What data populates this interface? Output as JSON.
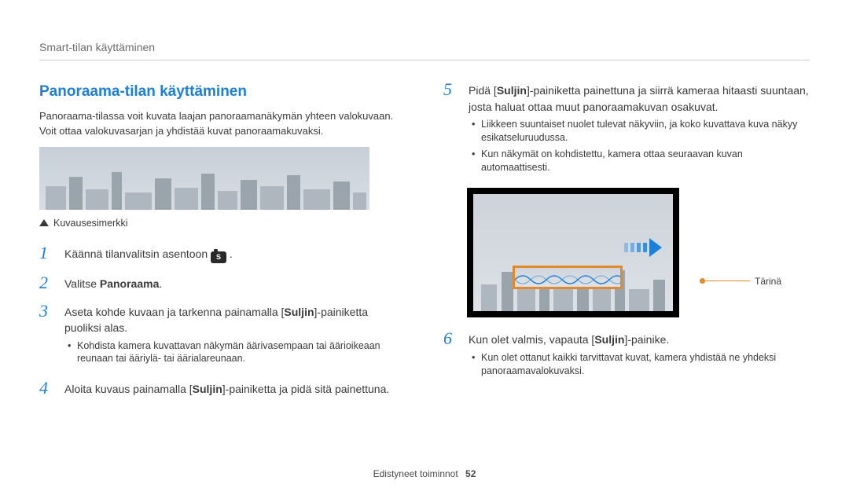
{
  "breadcrumb": "Smart-tilan käyttäminen",
  "section_title": "Panoraama-tilan käyttäminen",
  "intro": "Panoraama-tilassa voit kuvata laajan panoraamanäkymän yhteen valokuvaan. Voit ottaa valokuvasarjan ja yhdistää kuvat panoraamakuvaksi.",
  "caption": "Kuvausesimerkki",
  "mode_letter": "S",
  "steps": {
    "s1": {
      "num": "1",
      "pre": "Käännä tilanvalitsin asentoon ",
      "post": " ."
    },
    "s2": {
      "num": "2",
      "pre": "Valitse ",
      "bold": "Panoraama",
      "post": "."
    },
    "s3": {
      "num": "3",
      "line_a": "Aseta kohde kuvaan ja tarkenna painamalla [",
      "bold": "Suljin",
      "line_b": "]-painiketta puoliksi alas.",
      "sub1": "Kohdista kamera kuvattavan näkymän äärivasempaan tai äärioikeaan reunaan tai ääriylä- tai äärialareunaan."
    },
    "s4": {
      "num": "4",
      "line_a": "Aloita kuvaus painamalla [",
      "bold": "Suljin",
      "line_b": "]-painiketta ja pidä sitä painettuna."
    },
    "s5": {
      "num": "5",
      "line_a": "Pidä [",
      "bold": "Suljin",
      "line_b": "]-painiketta painettuna ja siirrä kameraa hitaasti suuntaan, josta haluat ottaa muut panoraamakuvan osakuvat.",
      "sub1": "Liikkeen suuntaiset nuolet tulevat näkyviin, ja koko kuvattava kuva näkyy esikatseluruudussa.",
      "sub2": "Kun näkymät on kohdistettu, kamera ottaa seuraavan kuvan automaattisesti."
    },
    "s6": {
      "num": "6",
      "line_a": "Kun olet valmis, vapauta [",
      "bold": "Suljin",
      "line_b": "]-painike.",
      "sub1": "Kun olet ottanut kaikki tarvittavat kuvat, kamera yhdistää ne yhdeksi panoraamavalokuvaksi."
    }
  },
  "callout": "Tärinä",
  "footer_label": "Edistyneet toiminnot",
  "footer_page": "52"
}
